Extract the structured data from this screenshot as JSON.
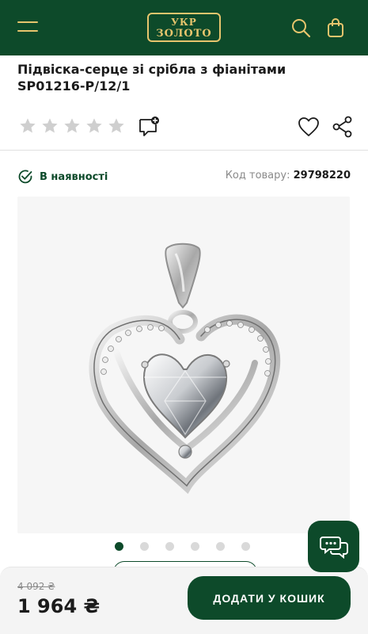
{
  "header": {
    "logo_line1": "УКР",
    "logo_line2": "ЗОЛОТО",
    "icons": [
      "menu-icon",
      "search-icon",
      "bag-icon"
    ],
    "background_color": "#0d4a2a",
    "accent_color": "#e7c56d"
  },
  "product": {
    "title": "Підвіска-серце зі срібла з фіанітами SP01216-P/12/1",
    "rating": 0,
    "rating_max": 5,
    "availability": "В наявності",
    "code_label": "Код товару:",
    "code_value": "29798220",
    "gallery_count": 6,
    "gallery_active": 1
  },
  "purchase": {
    "old_price": "4 092 ₴",
    "price": "1 964 ₴",
    "add_to_cart": "ДОДАТИ У КОШИК"
  }
}
